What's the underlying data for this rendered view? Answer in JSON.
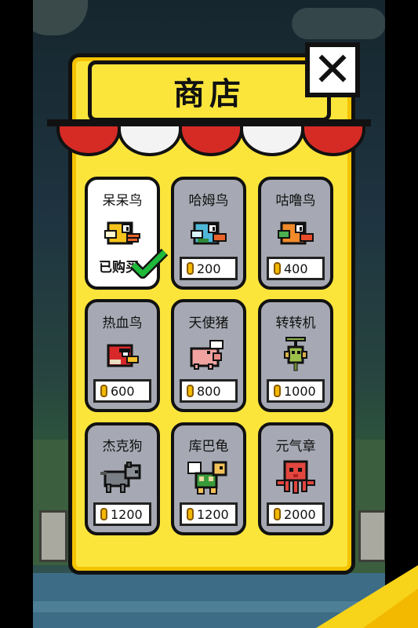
{
  "shop": {
    "title": "商店",
    "close_icon": "close-x-icon",
    "owned_label": "已购买",
    "coin_icon": "gold-coin-icon",
    "items": [
      {
        "name": "呆呆鸟",
        "price": "",
        "owned": true,
        "icon": "yellow-flappy-bird-icon"
      },
      {
        "name": "哈姆鸟",
        "price": "200",
        "owned": false,
        "icon": "blue-bird-icon"
      },
      {
        "name": "咕噜鸟",
        "price": "400",
        "owned": false,
        "icon": "orange-bird-icon"
      },
      {
        "name": "热血鸟",
        "price": "600",
        "owned": false,
        "icon": "red-angry-bird-icon"
      },
      {
        "name": "天使猪",
        "price": "800",
        "owned": false,
        "icon": "winged-pig-icon"
      },
      {
        "name": "转转机",
        "price": "1000",
        "owned": false,
        "icon": "propeller-bug-icon"
      },
      {
        "name": "杰克狗",
        "price": "1200",
        "owned": false,
        "icon": "gray-dog-icon"
      },
      {
        "name": "库巴龟",
        "price": "1200",
        "owned": false,
        "icon": "winged-turtle-icon"
      },
      {
        "name": "元气章",
        "price": "2000",
        "owned": false,
        "icon": "red-octopus-icon"
      }
    ]
  },
  "colors": {
    "panel_yellow": "#fce53b",
    "card_gray": "#a6a9b3",
    "awning_red": "#d62b25",
    "check_green": "#1eb83a",
    "coin_gold": "#f2b900"
  }
}
